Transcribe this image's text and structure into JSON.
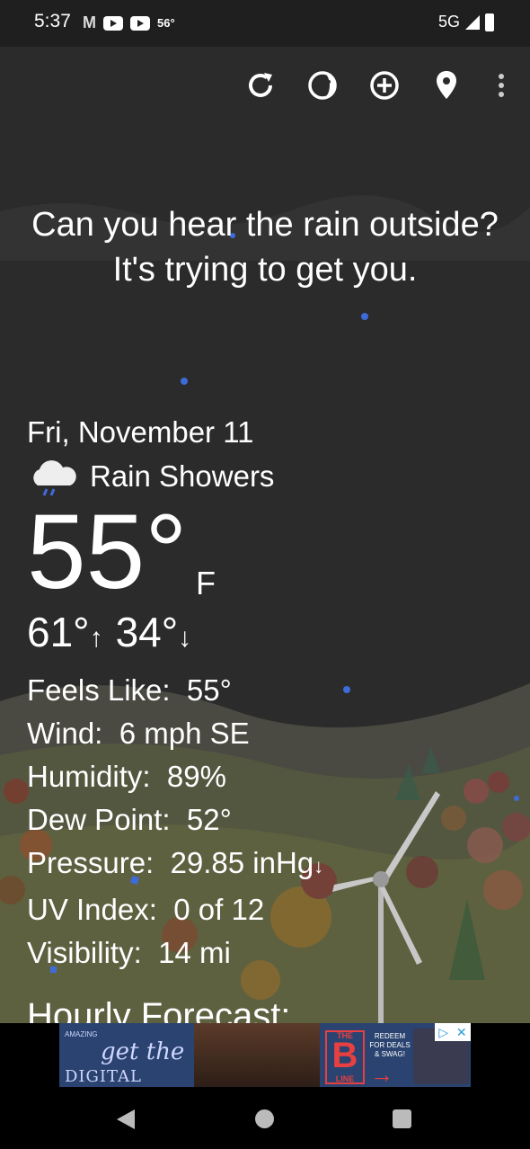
{
  "status_bar": {
    "time": "5:37",
    "mail_icon_letter": "M",
    "temp": "56°",
    "network": "5G"
  },
  "toolbar": {
    "icons": [
      "refresh-icon",
      "moon-phase-icon",
      "add-location-icon",
      "location-pin-icon",
      "more-vert-icon"
    ]
  },
  "headline": "Can you hear the rain outside? It's trying to get you.",
  "weather": {
    "date": "Fri, November 11",
    "condition": "Rain Showers",
    "temperature": "55°",
    "unit": "F",
    "high": "61°",
    "low": "34°",
    "details": [
      {
        "label": "Feels Like:",
        "value": "55°"
      },
      {
        "label": "Wind:",
        "value": "6 mph SE"
      },
      {
        "label": "Humidity:",
        "value": "89%"
      },
      {
        "label": "Dew Point:",
        "value": "52°"
      },
      {
        "label": "Pressure:",
        "value": "29.85 inHg"
      },
      {
        "label": "UV Index:",
        "value": "0 of 12"
      },
      {
        "label": "Visibility:",
        "value": "14 mi"
      }
    ]
  },
  "hourly_title": "Hourly Forecast:",
  "ad": {
    "brand_small": "AMAZING",
    "script": "get the",
    "digital_pass": "DIGITAL PASS",
    "b_the": "THE",
    "b_letter": "B",
    "b_line": "LINE",
    "redeem": "REDEEM FOR DEALS & SWAG!"
  },
  "colors": {
    "sky": "#2b2b2b",
    "accent_blue": "#3e6bd9",
    "ad_blue": "#2a4370"
  }
}
